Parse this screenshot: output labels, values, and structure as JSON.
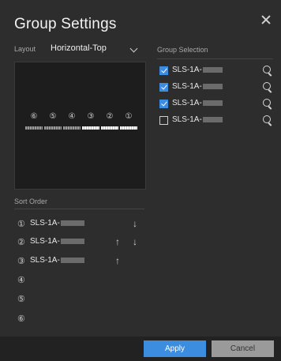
{
  "dialog": {
    "title": "Group Settings"
  },
  "layout": {
    "label": "Layout",
    "value": "Horizontal-Top"
  },
  "preview": {
    "slots": [
      {
        "num": "⑥",
        "highlight": false
      },
      {
        "num": "⑤",
        "highlight": false
      },
      {
        "num": "④",
        "highlight": false
      },
      {
        "num": "③",
        "highlight": true
      },
      {
        "num": "②",
        "highlight": true
      },
      {
        "num": "①",
        "highlight": true
      }
    ]
  },
  "group_selection": {
    "label": "Group Selection",
    "items": [
      {
        "label": "SLS-1A-",
        "checked": true
      },
      {
        "label": "SLS-1A-",
        "checked": true
      },
      {
        "label": "SLS-1A-",
        "checked": true
      },
      {
        "label": "SLS-1A-",
        "checked": false
      }
    ]
  },
  "sort_order": {
    "label": "Sort Order",
    "rows": [
      {
        "num": "①",
        "label": "SLS-1A-",
        "up": false,
        "down": true
      },
      {
        "num": "②",
        "label": "SLS-1A-",
        "up": true,
        "down": true
      },
      {
        "num": "③",
        "label": "SLS-1A-",
        "up": true,
        "down": false
      },
      {
        "num": "④",
        "label": "",
        "up": false,
        "down": false
      },
      {
        "num": "⑤",
        "label": "",
        "up": false,
        "down": false
      },
      {
        "num": "⑥",
        "label": "",
        "up": false,
        "down": false
      }
    ]
  },
  "arrows": {
    "up": "↑",
    "down": "↓"
  },
  "buttons": {
    "apply": "Apply",
    "cancel": "Cancel"
  },
  "colors": {
    "accent": "#3c8de0",
    "background": "#2d2d2d"
  }
}
